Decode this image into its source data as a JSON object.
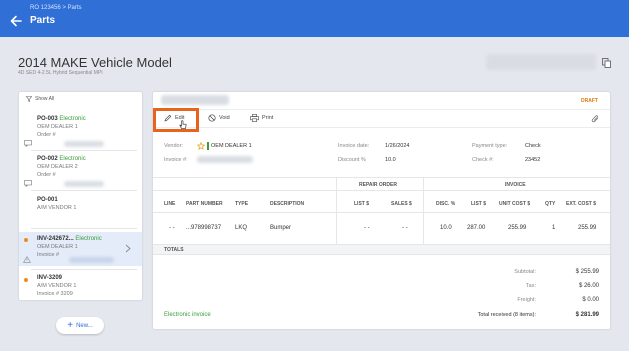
{
  "header": {
    "breadcrumb": "RO 123456 > Parts",
    "title": "Parts"
  },
  "vehicle": {
    "title": "2014 MAKE Vehicle Model",
    "subtitle": "4D SED 4-2.5L Hybrid Sequential MPI"
  },
  "sidebar": {
    "filter_label": "Show All",
    "items": [
      {
        "number": "PO-003",
        "type": "Electronic",
        "dealer": "OEM DEALER 1",
        "sub": "Order #"
      },
      {
        "number": "PO-002",
        "type": "Electronic",
        "dealer": "OEM DEALER 2",
        "sub": "Order #"
      },
      {
        "number": "PO-001",
        "type": "",
        "dealer": "A/M VENDOR 1",
        "sub": ""
      },
      {
        "number": "INV-242672...",
        "type": "Electronic",
        "dealer": "OEM DEALER 1",
        "sub": "Invoice #"
      },
      {
        "number": "INV-3209",
        "type": "",
        "dealer": "A/M VENDOR 1",
        "sub": "Invoice # 3209"
      }
    ],
    "new_button": "New..."
  },
  "document": {
    "status": "DRAFT",
    "toolbar": {
      "edit": "Edit",
      "void": "Void",
      "print": "Print"
    },
    "fields": {
      "vendor_label": "Vendor:",
      "vendor_value": "OEM DEALER 1",
      "invoice_no_label": "Invoice #:",
      "invoice_date_label": "Invoice date:",
      "invoice_date_value": "1/26/2024",
      "discount_label": "Discount %",
      "discount_value": "10.0",
      "payment_type_label": "Payment type:",
      "payment_type_value": "Check",
      "check_no_label": "Check #:",
      "check_no_value": "23452"
    },
    "table": {
      "group_repair_order": "REPAIR ORDER",
      "group_invoice": "INVOICE",
      "columns": {
        "line": "LINE",
        "part_number": "PART NUMBER",
        "type": "TYPE",
        "description": "DESCRIPTION",
        "list": "LIST $",
        "sales": "SALES $",
        "disc": "DISC. %",
        "inv_list": "LIST $",
        "unit_cost": "UNIT COST $",
        "qty": "QTY",
        "ext_cost": "EXT. COST $"
      },
      "rows": [
        {
          "line": "- -",
          "part_number": "...978998737",
          "type": "LKQ",
          "description": "Bumper",
          "list": "- -",
          "sales": "- -",
          "disc": "10.0",
          "inv_list": "287.00",
          "unit_cost": "255.99",
          "qty": "1",
          "ext_cost": "255.99"
        }
      ]
    },
    "totals": {
      "header": "TOTALS",
      "subtotal_label": "Subtotal:",
      "subtotal_value": "$ 255.99",
      "tax_label": "Tax:",
      "tax_value": "$ 26.00",
      "freight_label": "Freight:",
      "freight_value": "$ 0.00",
      "total_label": "Total received (8 items):",
      "total_value": "$ 281.99"
    },
    "electronic_invoice": "Electronic invoice"
  },
  "colors": {
    "primary": "#2f6fd6",
    "accent_orange": "#e8641e",
    "electronic_green": "#3a9d3a",
    "draft_orange": "#e07a10"
  }
}
